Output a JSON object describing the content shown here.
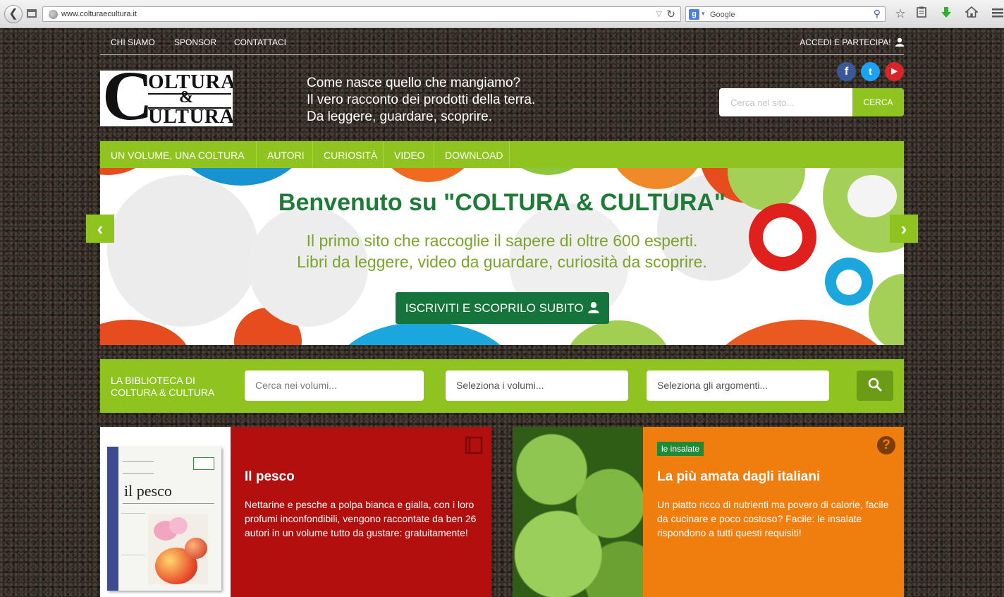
{
  "browser": {
    "url": "www.colturaecultura.it",
    "search_placeholder": "Google",
    "search_engine_letter": "g"
  },
  "top_nav": {
    "links": [
      "CHI SIAMO",
      "SPONSOR",
      "CONTATTACI"
    ],
    "login": "ACCEDI E PARTECIPA!"
  },
  "logo": {
    "letter": "C",
    "line1": "OLTURA",
    "amp": "&",
    "line2": "ULTURA"
  },
  "tagline": {
    "line1": "Come nasce quello che mangiamo?",
    "line2": "Il vero racconto dei prodotti della terra.",
    "line3": "Da leggere, guardare, scoprire."
  },
  "social": {
    "facebook": "f",
    "twitter": "t",
    "youtube": "▶",
    "colors": {
      "facebook": "#3b5998",
      "twitter": "#1da1f2",
      "youtube": "#d9252a"
    }
  },
  "site_search": {
    "placeholder": "Cerca nel sito...",
    "button": "CERCA"
  },
  "main_nav": {
    "items": [
      "UN VOLUME, UNA COLTURA",
      "AUTORI",
      "CURIOSITÀ",
      "VIDEO",
      "DOWNLOAD"
    ]
  },
  "hero": {
    "title": "Benvenuto su \"COLTURA & CULTURA\"",
    "sub1": "Il primo sito che raccoglie il sapere di oltre 600 esperti.",
    "sub2": "Libri da leggere, video da guardare, curiosità da scoprire.",
    "cta": "ISCRIVITI E SCOPRILO SUBITO"
  },
  "library": {
    "label1": "LA BIBLIOTECA DI",
    "label2": "COLTURA & CULTURA",
    "field1": "Cerca nei volumi...",
    "field2": "Seleziona i volumi...",
    "field3": "Seleziona gli argomenti..."
  },
  "cards": [
    {
      "title": "Il pesco",
      "text": "Nettarine e pesche a polpa bianca e gialla, con i loro profumi inconfondibili, vengono raccontate da ben 26 autori in un volume tutto da gustare: gratuitamente!",
      "book_title": "il pesco",
      "color": "#b30f0f"
    },
    {
      "tag": "le insalate",
      "title": "La più amata dagli italiani",
      "text": "Un piatto ricco di nutrienti ma povero di calorie, facile da cucinare e poco costoso? Facile: le insalate rispondono a tutti questi requisiti!",
      "color": "#f07e0f"
    }
  ],
  "colors": {
    "accent_green": "#8fc31f",
    "dark_green": "#15743b"
  }
}
